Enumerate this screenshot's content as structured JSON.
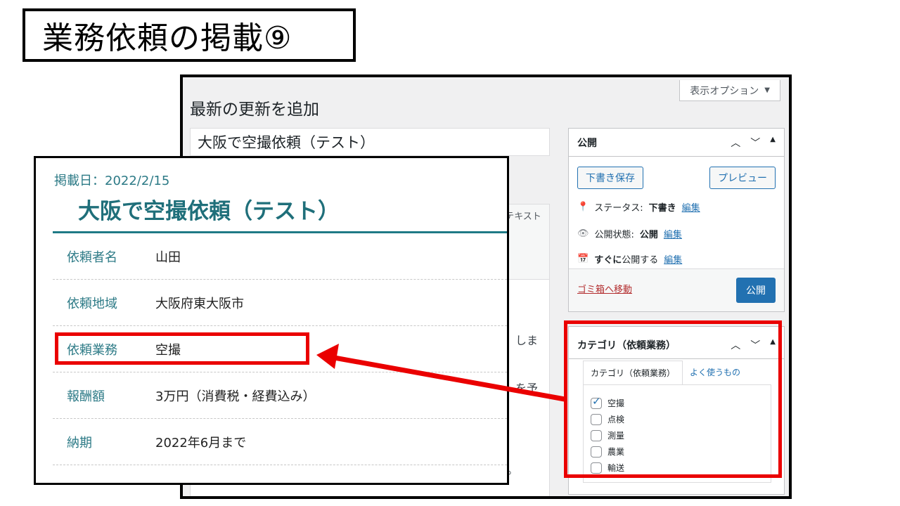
{
  "slide": {
    "title": "業務依頼の掲載⑨"
  },
  "wp": {
    "screen_options": "表示オプション",
    "page_title": "最新の更新を追加",
    "post_title": "大阪で空撮依頼（テスト）",
    "editor_tab_text": "テキスト",
    "editor_fragments": [
      "しま",
      "を予",
      "。"
    ],
    "publish": {
      "title": "公開",
      "save_draft": "下書き保存",
      "preview": "プレビュー",
      "status_label": "ステータス:",
      "status_value": "下書き",
      "visibility_label": "公開状態:",
      "visibility_value": "公開",
      "schedule_label": "すぐに",
      "schedule_rest": "公開する",
      "edit_link": "編集",
      "trash_link": "ゴミ箱へ移動",
      "publish_button": "公開"
    },
    "categories": {
      "title": "カテゴリ（依頼業務）",
      "tab_all": "カテゴリ（依頼業務）",
      "tab_popular": "よく使うもの",
      "items": [
        {
          "label": "空撮",
          "checked": true
        },
        {
          "label": "点検",
          "checked": false
        },
        {
          "label": "測量",
          "checked": false
        },
        {
          "label": "農業",
          "checked": false
        },
        {
          "label": "輸送",
          "checked": false
        }
      ]
    }
  },
  "preview": {
    "date": "掲載日：2022/2/15",
    "heading": "大阪で空撮依頼（テスト）",
    "rows": [
      {
        "label": "依頼者名",
        "value": "山田"
      },
      {
        "label": "依頼地域",
        "value": "大阪府東大阪市"
      },
      {
        "label": "依頼業務",
        "value": "空撮"
      },
      {
        "label": "報酬額",
        "value": "3万円（消費税・経費込み）"
      },
      {
        "label": "納期",
        "value": "2022年6月まで"
      }
    ]
  },
  "colors": {
    "highlight": "#ea0000",
    "wp_blue": "#2271b1",
    "teal": "#1f7a86"
  }
}
